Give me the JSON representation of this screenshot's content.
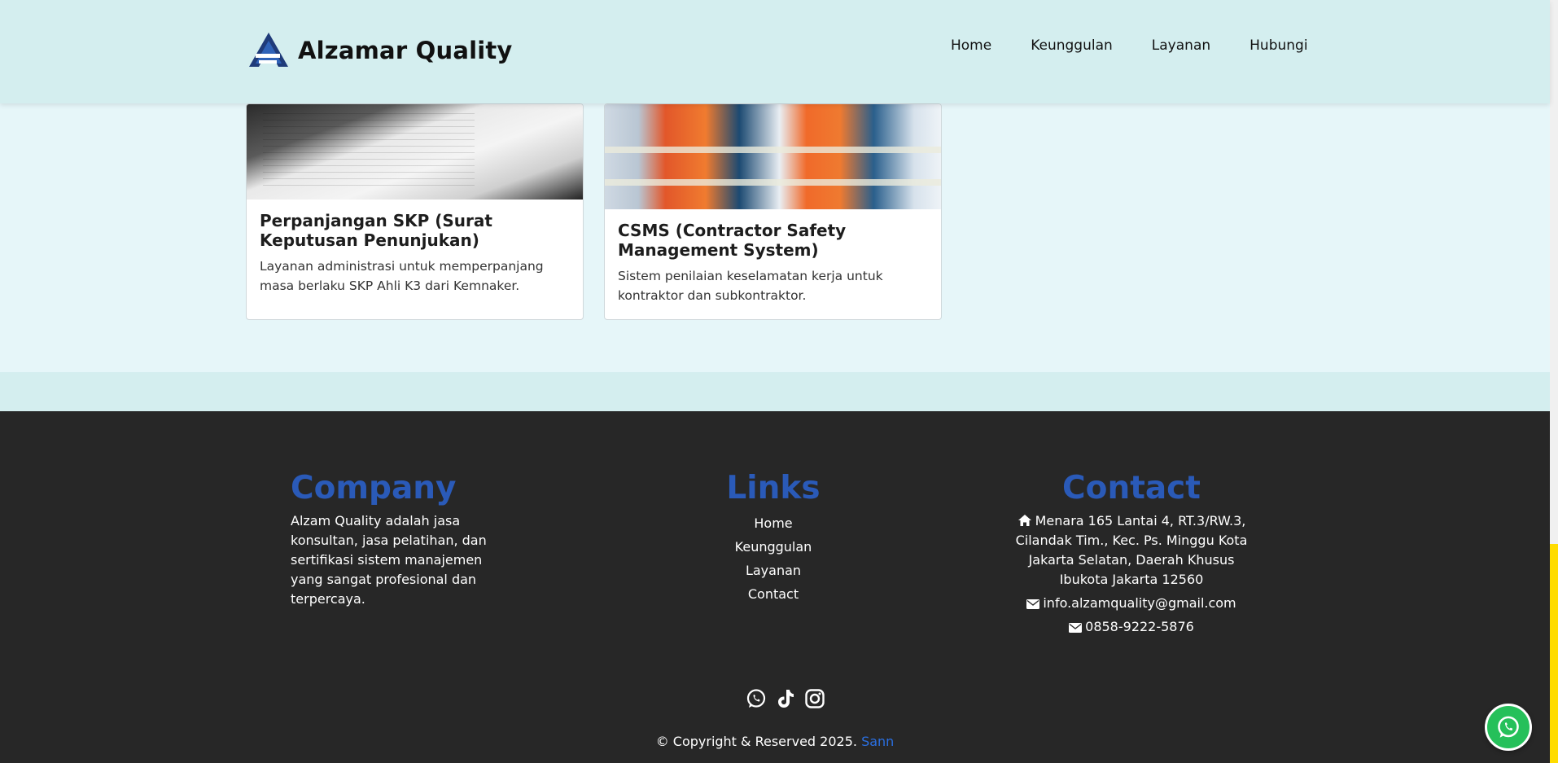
{
  "header": {
    "brand": "Alzamar Quality",
    "nav": [
      "Home",
      "Keunggulan",
      "Layanan",
      "Hubungi"
    ]
  },
  "cards": [
    {
      "title": "Perpanjangan SKP (Surat Keputusan Penunjukan)",
      "description": "Layanan administrasi untuk memperpanjang masa berlaku SKP Ahli K3 dari Kemnaker."
    },
    {
      "title": "CSMS (Contractor Safety Management System)",
      "description": "Sistem penilaian keselamatan kerja untuk kontraktor dan subkontraktor."
    }
  ],
  "footer": {
    "company": {
      "title": "Company",
      "text": "Alzam Quality adalah jasa konsultan, jasa pelatihan, dan sertifikasi sistem manajemen yang sangat profesional dan terpercaya."
    },
    "links": {
      "title": "Links",
      "items": [
        "Home",
        "Keunggulan",
        "Layanan",
        "Contact"
      ]
    },
    "contact": {
      "title": "Contact",
      "address": "Menara 165 Lantai 4, RT.3/RW.3, Cilandak Tim., Kec. Ps. Minggu Kota Jakarta Selatan, Daerah Khusus Ibukota Jakarta 12560",
      "email": "info.alzamquality@gmail.com",
      "phone": "0858-9222-5876"
    },
    "copyright": "© Copyright & Reserved 2025.",
    "author": "Sann"
  },
  "colors": {
    "accent": "#2a5ab8",
    "header_bg": "#d4eeef",
    "footer_bg": "#272727",
    "whatsapp": "#25c05a",
    "scroll_thumb": "#ffdc00"
  },
  "icons": [
    "logo-icon",
    "home-icon",
    "mail-icon",
    "whatsapp-icon",
    "tiktok-icon",
    "instagram-icon"
  ]
}
